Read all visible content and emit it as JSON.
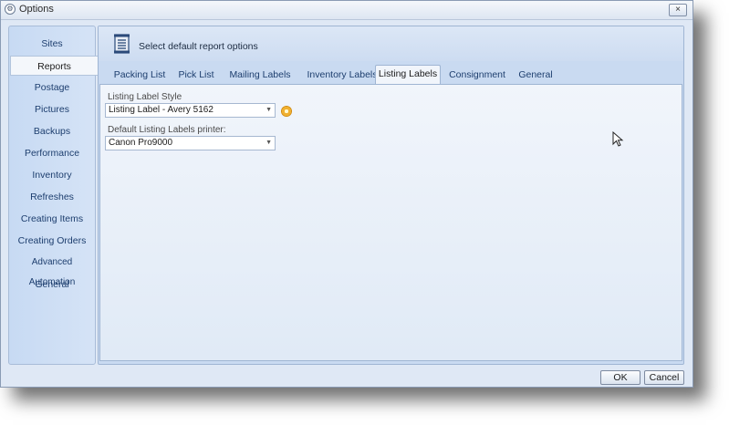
{
  "window": {
    "title": "Options",
    "close_symbol": "×"
  },
  "sidebar": {
    "items": [
      {
        "label": "Sites"
      },
      {
        "label": "Reports",
        "active": true
      },
      {
        "label": "Postage"
      },
      {
        "label": "Pictures"
      },
      {
        "label": "Backups"
      },
      {
        "label": "Performance"
      },
      {
        "label": "Inventory"
      },
      {
        "label": "Refreshes"
      },
      {
        "label": "Creating Items"
      },
      {
        "label": "Creating Orders"
      },
      {
        "label": "Advanced Automation"
      },
      {
        "label": "General"
      }
    ]
  },
  "header": {
    "text": "Select default report options"
  },
  "tabs": [
    {
      "label": "Packing List"
    },
    {
      "label": "Pick List"
    },
    {
      "label": "Mailing Labels"
    },
    {
      "label": "Inventory Labels"
    },
    {
      "label": "Listing Labels",
      "active": true
    },
    {
      "label": "Consignment"
    },
    {
      "label": "General"
    }
  ],
  "form": {
    "style_label": "Listing Label Style",
    "style_value": "Listing Label - Avery 5162",
    "printer_label": "Default Listing Labels printer:",
    "printer_value": "Canon Pro9000"
  },
  "footer": {
    "ok_label": "OK",
    "cancel_label": "Cancel"
  },
  "colors": {
    "accent": "#1d3e6e",
    "panel": "#f1f5fb"
  }
}
